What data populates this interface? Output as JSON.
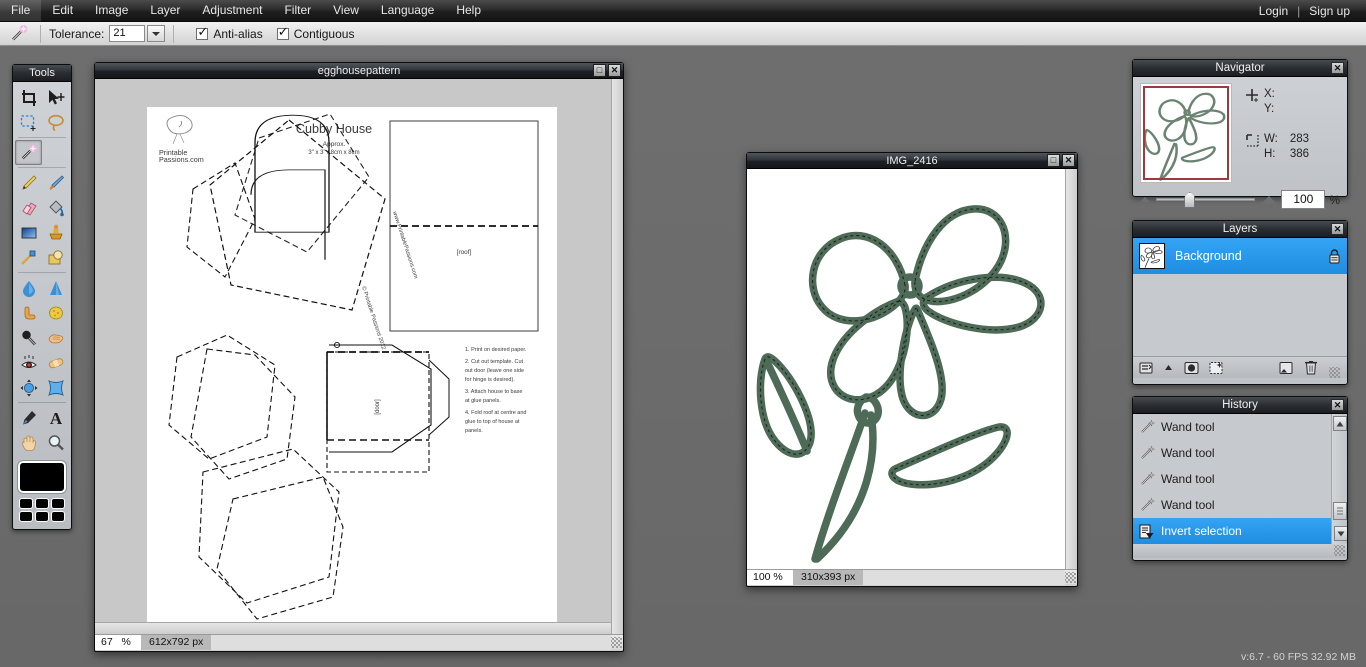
{
  "app": {
    "version_status": "v:6.7 - 60 FPS 32.92 MB"
  },
  "menubar": {
    "items": [
      {
        "label": "File"
      },
      {
        "label": "Edit"
      },
      {
        "label": "Image"
      },
      {
        "label": "Layer"
      },
      {
        "label": "Adjustment"
      },
      {
        "label": "Filter"
      },
      {
        "label": "View"
      },
      {
        "label": "Language"
      },
      {
        "label": "Help"
      }
    ],
    "login_label": "Login",
    "separator": "|",
    "signup_label": "Sign up"
  },
  "options_bar": {
    "active_tool_icon": "magic-wand-icon",
    "tolerance_label": "Tolerance:",
    "tolerance_value": "21",
    "antialias_label": "Anti-alias",
    "antialias_checked": true,
    "contiguous_label": "Contiguous",
    "contiguous_checked": true
  },
  "tools_panel": {
    "title": "Tools",
    "close_label": "✕",
    "items": [
      {
        "name": "crop-tool-icon",
        "selected": false
      },
      {
        "name": "move-tool-icon",
        "selected": false
      },
      {
        "name": "marquee-select-tool-icon",
        "selected": false
      },
      {
        "name": "lasso-tool-icon",
        "selected": false
      },
      {
        "name": "magic-wand-tool-icon",
        "selected": true
      },
      {
        "name": "pencil-tool-icon",
        "selected": false
      },
      {
        "name": "brush-tool-icon",
        "selected": false
      },
      {
        "name": "eraser-tool-icon",
        "selected": false
      },
      {
        "name": "paint-bucket-tool-icon",
        "selected": false
      },
      {
        "name": "gradient-tool-icon",
        "selected": false
      },
      {
        "name": "clone-stamp-tool-icon",
        "selected": false
      },
      {
        "name": "replace-color-tool-icon",
        "selected": false
      },
      {
        "name": "shape-tool-icon",
        "selected": false
      },
      {
        "name": "blur-tool-icon",
        "selected": false
      },
      {
        "name": "sharpen-tool-icon",
        "selected": false
      },
      {
        "name": "smudge-tool-icon",
        "selected": false
      },
      {
        "name": "sponge-tool-icon",
        "selected": false
      },
      {
        "name": "dodge-tool-icon",
        "selected": false
      },
      {
        "name": "burn-tool-icon",
        "selected": false
      },
      {
        "name": "red-eye-tool-icon",
        "selected": false
      },
      {
        "name": "heal-tool-icon",
        "selected": false
      },
      {
        "name": "bloat-tool-icon",
        "selected": false
      },
      {
        "name": "pinch-tool-icon",
        "selected": false
      },
      {
        "name": "eyedropper-tool-icon",
        "selected": false
      },
      {
        "name": "type-tool-icon",
        "selected": false
      },
      {
        "name": "hand-tool-icon",
        "selected": false
      },
      {
        "name": "zoom-tool-icon",
        "selected": false
      }
    ],
    "foreground_color": "#000000",
    "palette_colors": [
      "#000000",
      "#000000",
      "#000000",
      "#000000",
      "#000000",
      "#000000"
    ]
  },
  "documents": [
    {
      "id": "egghousepattern",
      "title": "egghousepattern",
      "zoom": "67",
      "zoom_unit": "%",
      "dimensions": "612x792 px",
      "minimize_label": "□",
      "close_label": "✕",
      "content": {
        "heading": "Cubby House",
        "subheading": "Approx.",
        "size_line": "3\" x 3\" / 8cm x 8cm",
        "watermark": "Printable Passions.com",
        "side_text": "www.PrintablePassions.com",
        "side_text_2": "© Printable Passions 2012",
        "door_label": "[door]",
        "roof_label": "[roof]",
        "instructions": [
          "1. Print on desired paper.",
          "2. Cut out template. Cut out door (leave one side for hinge is desired).",
          "3. Attach house to base at glue panels.",
          "4. Fold roof at centre and glue to top of house at panels."
        ]
      }
    },
    {
      "id": "IMG_2416",
      "title": "IMG_2416",
      "zoom": "100 %",
      "dimensions": "310x393 px",
      "minimize_label": "□",
      "close_label": "✕",
      "content": {
        "subject": "hand-drawn flower with petals and leaves",
        "stroke_color": "#4e6b57",
        "selection_active": true
      }
    }
  ],
  "navigator": {
    "title": "Navigator",
    "close_label": "✕",
    "pointer_icon": "crosshair-icon",
    "selection_icon": "selection-bounds-icon",
    "x_label": "X:",
    "y_label": "Y:",
    "x_value": "",
    "y_value": "",
    "w_label": "W:",
    "h_label": "H:",
    "w_value": "283",
    "h_value": "386",
    "zoom_value": "100",
    "zoom_unit": "%",
    "zoom_out_icon": "zoom-out-triangle-icon",
    "zoom_in_icon": "zoom-in-triangle-icon"
  },
  "layers": {
    "title": "Layers",
    "close_label": "✕",
    "rows": [
      {
        "name": "Background",
        "selected": true,
        "locked": true,
        "lock_icon": "lock-icon"
      }
    ],
    "toolbar_icons": [
      "layer-properties-icon",
      "layer-menu-arrow-icon",
      "layer-mask-icon",
      "new-adjustment-layer-icon",
      "new-layer-icon",
      "delete-layer-icon"
    ]
  },
  "history": {
    "title": "History",
    "close_label": "✕",
    "rows": [
      {
        "label": "Wand tool",
        "icon": "magic-wand-icon",
        "selected": false
      },
      {
        "label": "Wand tool",
        "icon": "magic-wand-icon",
        "selected": false
      },
      {
        "label": "Wand tool",
        "icon": "magic-wand-icon",
        "selected": false
      },
      {
        "label": "Wand tool",
        "icon": "magic-wand-icon",
        "selected": false
      },
      {
        "label": "Invert selection",
        "icon": "invert-selection-icon",
        "selected": true
      }
    ],
    "scroll_up_icon": "scroll-up-arrow-icon",
    "scroll_down_icon": "scroll-down-arrow-icon"
  }
}
